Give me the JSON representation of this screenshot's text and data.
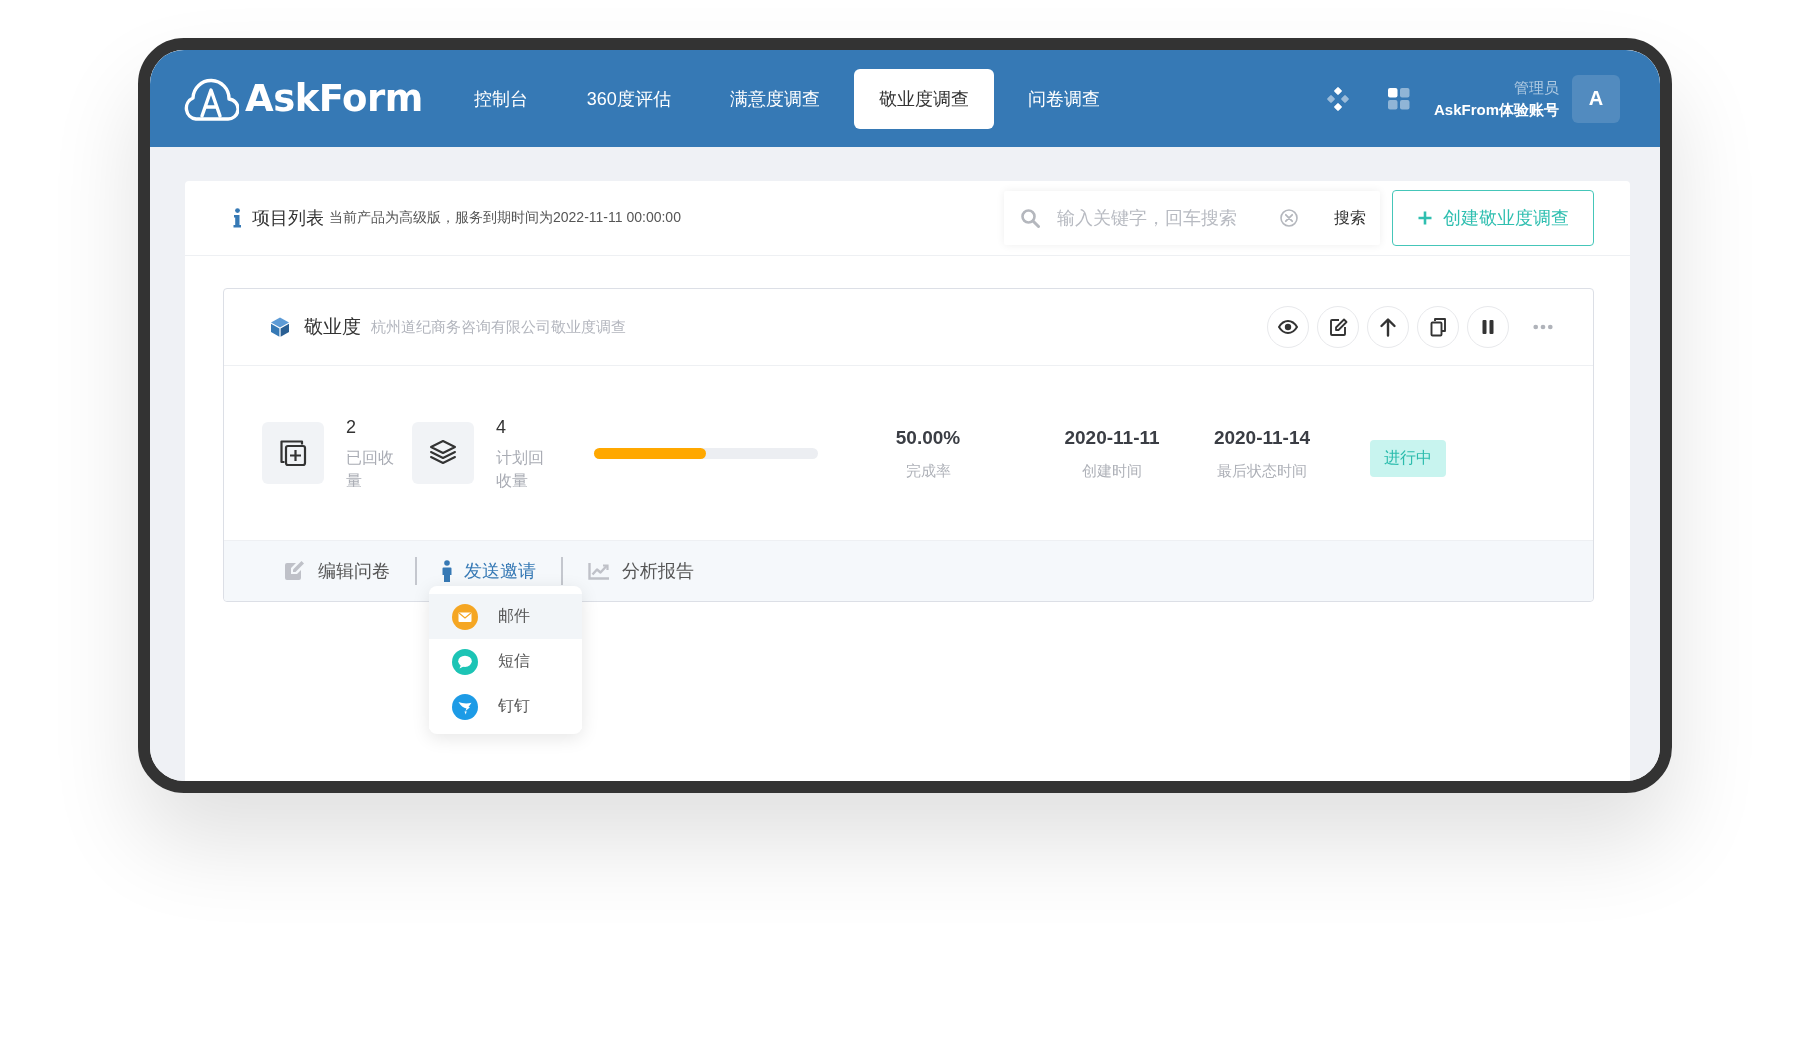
{
  "header": {
    "logo": "AskForm",
    "nav": [
      {
        "label": "控制台",
        "selected": false
      },
      {
        "label": "360度评估",
        "selected": false
      },
      {
        "label": "满意度调查",
        "selected": false
      },
      {
        "label": "敬业度调查",
        "selected": true
      },
      {
        "label": "问卷调查",
        "selected": false
      }
    ],
    "user": {
      "role": "管理员",
      "name": "AskFrom体验账号",
      "avatar": "A"
    }
  },
  "toolbar": {
    "title": "项目列表",
    "subtitle": "当前产品为高级版，服务到期时间为2022-11-11 00:00:00",
    "search": {
      "placeholder": "输入关键字，回车搜索",
      "button": "搜索"
    },
    "create_button": "创建敬业度调查"
  },
  "project": {
    "title": "敬业度",
    "description": "杭州道纪商务咨询有限公司敬业度调查",
    "stats": [
      {
        "kind": "collected",
        "value": "2",
        "label": "已回收量"
      },
      {
        "kind": "planned",
        "value": "4",
        "label": "计划回收量"
      }
    ],
    "progress": {
      "level": 0.5
    },
    "metrics": [
      {
        "value": "50.00%",
        "label": "完成率"
      },
      {
        "value": "2020-11-11",
        "label": "创建时间"
      },
      {
        "value": "2020-11-14",
        "label": "最后状态时间"
      }
    ],
    "status": {
      "label": "进行中",
      "kind": "active"
    },
    "tabs": [
      {
        "kind": "edit",
        "label": "编辑问卷",
        "selected": false
      },
      {
        "kind": "invite",
        "label": "发送邀请",
        "selected": true
      },
      {
        "kind": "report",
        "label": "分析报告",
        "selected": false
      }
    ],
    "invite_menu": [
      {
        "kind": "email",
        "label": "邮件",
        "color": "#f5a623",
        "selected": true
      },
      {
        "kind": "sms",
        "label": "短信",
        "color": "#1cc4b5",
        "selected": false
      },
      {
        "kind": "dingtalk",
        "label": "钉钉",
        "color": "#1d9be6",
        "selected": false
      }
    ]
  }
}
